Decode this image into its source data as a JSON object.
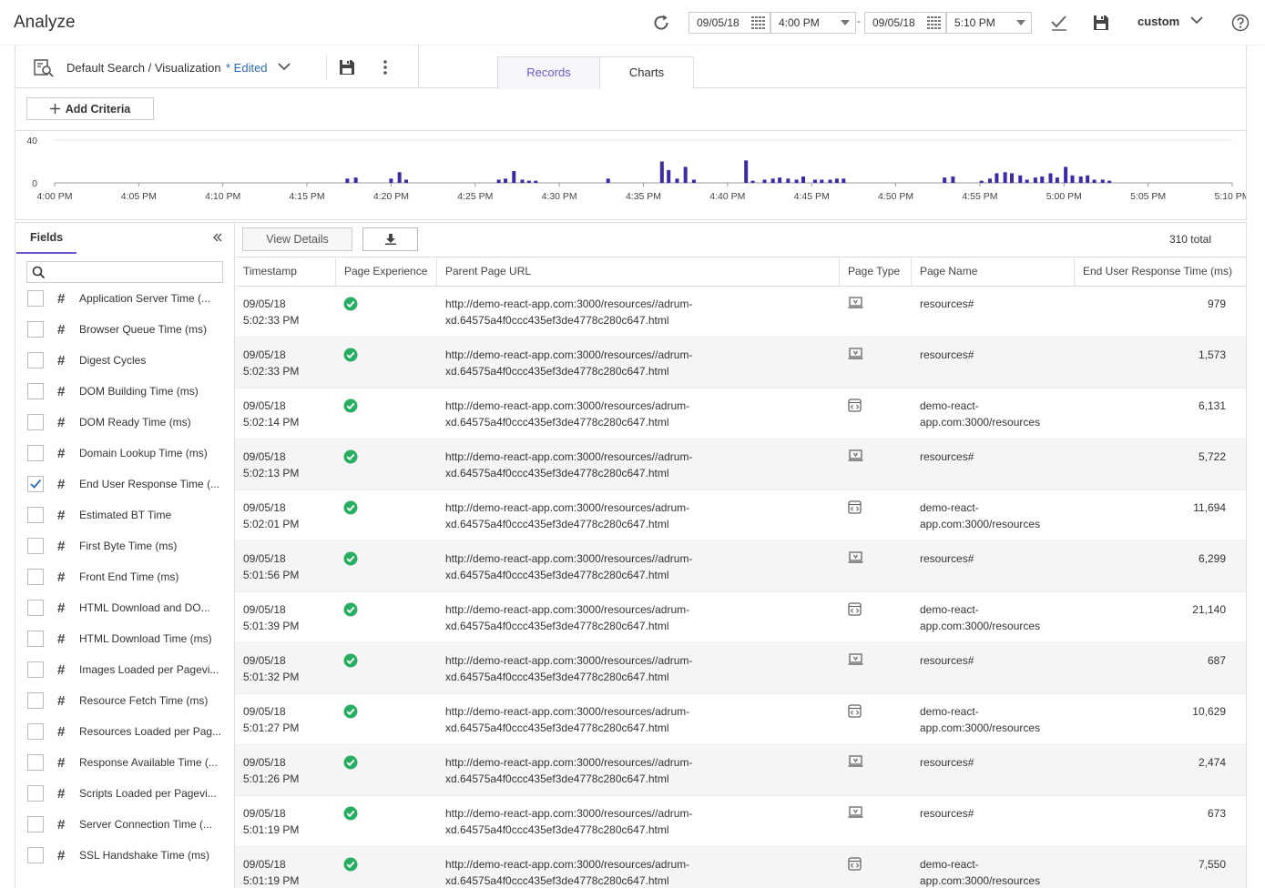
{
  "app": {
    "title": "Analyze"
  },
  "time_range": {
    "start_date": "09/05/18",
    "start_time": "4:00 PM",
    "separator": "-",
    "end_date": "09/05/18",
    "end_time": "5:10 PM",
    "range": "custom"
  },
  "search": {
    "name": "Default Search / Visualization",
    "edited_label": "* Edited",
    "add_criteria_label": "Add Criteria"
  },
  "tabs": [
    {
      "label": "Records",
      "active": true
    },
    {
      "label": "Charts",
      "active": false
    }
  ],
  "chart_data": {
    "type": "bar",
    "x_tick_labels": [
      "4:00 PM",
      "4:05 PM",
      "4:10 PM",
      "4:15 PM",
      "4:20 PM",
      "4:25 PM",
      "4:30 PM",
      "4:35 PM",
      "4:40 PM",
      "4:45 PM",
      "4:50 PM",
      "4:55 PM",
      "5:00 PM",
      "5:05 PM",
      "5:10 PM"
    ],
    "x_range_minutes": [
      0,
      70
    ],
    "ylim": [
      0,
      40
    ],
    "y_tick_labels": [
      "40",
      "0"
    ],
    "bar_color": "#3d2aa8",
    "bars": [
      {
        "x": 17.4,
        "y": 4
      },
      {
        "x": 17.9,
        "y": 5
      },
      {
        "x": 20.0,
        "y": 4
      },
      {
        "x": 20.5,
        "y": 10
      },
      {
        "x": 20.9,
        "y": 3
      },
      {
        "x": 26.4,
        "y": 3
      },
      {
        "x": 26.8,
        "y": 4
      },
      {
        "x": 27.3,
        "y": 11
      },
      {
        "x": 27.8,
        "y": 3
      },
      {
        "x": 28.2,
        "y": 2
      },
      {
        "x": 28.6,
        "y": 2
      },
      {
        "x": 32.9,
        "y": 4
      },
      {
        "x": 36.1,
        "y": 20
      },
      {
        "x": 36.5,
        "y": 12
      },
      {
        "x": 37.0,
        "y": 4
      },
      {
        "x": 37.5,
        "y": 15
      },
      {
        "x": 38.0,
        "y": 3
      },
      {
        "x": 41.1,
        "y": 21
      },
      {
        "x": 41.5,
        "y": 2
      },
      {
        "x": 42.2,
        "y": 3
      },
      {
        "x": 42.7,
        "y": 4
      },
      {
        "x": 43.1,
        "y": 5
      },
      {
        "x": 43.6,
        "y": 4
      },
      {
        "x": 44.1,
        "y": 3
      },
      {
        "x": 44.5,
        "y": 6
      },
      {
        "x": 45.2,
        "y": 3
      },
      {
        "x": 45.6,
        "y": 3
      },
      {
        "x": 46.1,
        "y": 3
      },
      {
        "x": 46.5,
        "y": 4
      },
      {
        "x": 46.9,
        "y": 4
      },
      {
        "x": 52.9,
        "y": 5
      },
      {
        "x": 53.4,
        "y": 6
      },
      {
        "x": 55.1,
        "y": 2
      },
      {
        "x": 55.6,
        "y": 4
      },
      {
        "x": 56.0,
        "y": 9
      },
      {
        "x": 56.5,
        "y": 10
      },
      {
        "x": 56.9,
        "y": 9
      },
      {
        "x": 57.4,
        "y": 7
      },
      {
        "x": 57.8,
        "y": 3
      },
      {
        "x": 58.3,
        "y": 5
      },
      {
        "x": 58.7,
        "y": 6
      },
      {
        "x": 59.2,
        "y": 9
      },
      {
        "x": 59.6,
        "y": 5
      },
      {
        "x": 60.1,
        "y": 15
      },
      {
        "x": 60.5,
        "y": 7
      },
      {
        "x": 61.0,
        "y": 6
      },
      {
        "x": 61.4,
        "y": 7
      },
      {
        "x": 61.8,
        "y": 3
      },
      {
        "x": 62.3,
        "y": 3
      },
      {
        "x": 62.7,
        "y": 2
      }
    ]
  },
  "fields": {
    "tab_label": "Fields",
    "search_placeholder": "",
    "items": [
      {
        "label": "Application Server Time (...",
        "checked": false
      },
      {
        "label": "Browser Queue Time (ms)",
        "checked": false
      },
      {
        "label": "Digest Cycles",
        "checked": false
      },
      {
        "label": "DOM Building Time (ms)",
        "checked": false
      },
      {
        "label": "DOM Ready Time (ms)",
        "checked": false
      },
      {
        "label": "Domain Lookup Time (ms)",
        "checked": false
      },
      {
        "label": "End User Response Time (...",
        "checked": true
      },
      {
        "label": "Estimated BT Time",
        "checked": false
      },
      {
        "label": "First Byte Time (ms)",
        "checked": false
      },
      {
        "label": "Front End Time (ms)",
        "checked": false
      },
      {
        "label": "HTML Download and DO...",
        "checked": false
      },
      {
        "label": "HTML Download Time (ms)",
        "checked": false
      },
      {
        "label": "Images Loaded per Pagevi...",
        "checked": false
      },
      {
        "label": "Resource Fetch Time (ms)",
        "checked": false
      },
      {
        "label": "Resources Loaded per Pag...",
        "checked": false
      },
      {
        "label": "Response Available Time (...",
        "checked": false
      },
      {
        "label": "Scripts Loaded per Pagevi...",
        "checked": false
      },
      {
        "label": "Server Connection Time (...",
        "checked": false
      },
      {
        "label": "SSL Handshake Time (ms)",
        "checked": false
      }
    ]
  },
  "records": {
    "view_details_label": "View Details",
    "total_label": "310 total",
    "columns": [
      "Timestamp",
      "Page Experience",
      "Parent Page URL",
      "Page Type",
      "Page Name",
      "End User Response Time (ms)"
    ],
    "rows": [
      {
        "date": "09/05/18",
        "time": "5:02:33 PM",
        "url1": "http://demo-react-app.com:3000/resources//adrum-",
        "url2": "xd.64575a4f0ccc435ef3de4778c280c647.html",
        "page_type": "virtual",
        "name1": "resources#",
        "name2": "",
        "ert": "979"
      },
      {
        "date": "09/05/18",
        "time": "5:02:33 PM",
        "url1": "http://demo-react-app.com:3000/resources//adrum-",
        "url2": "xd.64575a4f0ccc435ef3de4778c280c647.html",
        "page_type": "virtual",
        "name1": "resources#",
        "name2": "",
        "ert": "1,573"
      },
      {
        "date": "09/05/18",
        "time": "5:02:14 PM",
        "url1": "http://demo-react-app.com:3000/resources/adrum-",
        "url2": "xd.64575a4f0ccc435ef3de4778c280c647.html",
        "page_type": "iframe",
        "name1": "demo-react-",
        "name2": "app.com:3000/resources",
        "ert": "6,131"
      },
      {
        "date": "09/05/18",
        "time": "5:02:13 PM",
        "url1": "http://demo-react-app.com:3000/resources//adrum-",
        "url2": "xd.64575a4f0ccc435ef3de4778c280c647.html",
        "page_type": "virtual",
        "name1": "resources#",
        "name2": "",
        "ert": "5,722"
      },
      {
        "date": "09/05/18",
        "time": "5:02:01 PM",
        "url1": "http://demo-react-app.com:3000/resources/adrum-",
        "url2": "xd.64575a4f0ccc435ef3de4778c280c647.html",
        "page_type": "iframe",
        "name1": "demo-react-",
        "name2": "app.com:3000/resources",
        "ert": "11,694"
      },
      {
        "date": "09/05/18",
        "time": "5:01:56 PM",
        "url1": "http://demo-react-app.com:3000/resources//adrum-",
        "url2": "xd.64575a4f0ccc435ef3de4778c280c647.html",
        "page_type": "virtual",
        "name1": "resources#",
        "name2": "",
        "ert": "6,299"
      },
      {
        "date": "09/05/18",
        "time": "5:01:39 PM",
        "url1": "http://demo-react-app.com:3000/resources/adrum-",
        "url2": "xd.64575a4f0ccc435ef3de4778c280c647.html",
        "page_type": "iframe",
        "name1": "demo-react-",
        "name2": "app.com:3000/resources",
        "ert": "21,140"
      },
      {
        "date": "09/05/18",
        "time": "5:01:32 PM",
        "url1": "http://demo-react-app.com:3000/resources//adrum-",
        "url2": "xd.64575a4f0ccc435ef3de4778c280c647.html",
        "page_type": "virtual",
        "name1": "resources#",
        "name2": "",
        "ert": "687"
      },
      {
        "date": "09/05/18",
        "time": "5:01:27 PM",
        "url1": "http://demo-react-app.com:3000/resources/adrum-",
        "url2": "xd.64575a4f0ccc435ef3de4778c280c647.html",
        "page_type": "iframe",
        "name1": "demo-react-",
        "name2": "app.com:3000/resources",
        "ert": "10,629"
      },
      {
        "date": "09/05/18",
        "time": "5:01:26 PM",
        "url1": "http://demo-react-app.com:3000/resources//adrum-",
        "url2": "xd.64575a4f0ccc435ef3de4778c280c647.html",
        "page_type": "virtual",
        "name1": "resources#",
        "name2": "",
        "ert": "2,474"
      },
      {
        "date": "09/05/18",
        "time": "5:01:19 PM",
        "url1": "http://demo-react-app.com:3000/resources//adrum-",
        "url2": "xd.64575a4f0ccc435ef3de4778c280c647.html",
        "page_type": "virtual",
        "name1": "resources#",
        "name2": "",
        "ert": "673"
      },
      {
        "date": "09/05/18",
        "time": "5:01:19 PM",
        "url1": "http://demo-react-app.com:3000/resources/adrum-",
        "url2": "xd.64575a4f0ccc435ef3de4778c280c647.html",
        "page_type": "iframe",
        "name1": "demo-react-",
        "name2": "app.com:3000/resources",
        "ert": "7,550"
      }
    ]
  },
  "colors": {
    "accent": "#6a5acd",
    "link": "#2a6ab9",
    "success": "#27ae60",
    "bar": "#3d2aa8"
  },
  "icons": {
    "refresh": "refresh-icon",
    "calendar": "calendar-icon",
    "apply": "check-icon",
    "save": "save-icon",
    "help": "help-icon",
    "search_viz": "search-visualization-icon",
    "more": "more-vertical-icon",
    "collapse": "double-chevron-left-icon",
    "download": "download-icon",
    "experience": "check-circle-icon",
    "page_virtual": "virtual-page-icon",
    "page_iframe": "iframe-icon"
  }
}
